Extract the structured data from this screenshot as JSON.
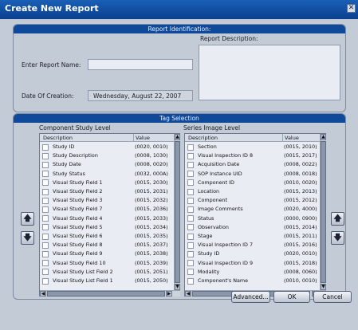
{
  "window": {
    "title": "Create New Report"
  },
  "report_identification": {
    "header": "Report Identification:",
    "name_label": "Enter Report Name:",
    "name_value": "",
    "description_label": "Report Description:",
    "date_label": "Date Of Creation:",
    "date_value": "Wednesday, August 22, 2007"
  },
  "tag_selection": {
    "header": "Tag Selection",
    "component_level": {
      "title": "Component Study Level",
      "columns": [
        "Description",
        "Value"
      ],
      "rows": [
        [
          "Study ID",
          "(0020, 0010)"
        ],
        [
          "Study Description",
          "(0008, 1030)"
        ],
        [
          "Study Date",
          "(0008, 0020)"
        ],
        [
          "Study Status",
          "(0032, 000A)"
        ],
        [
          "Visual Study Field 1",
          "(0015, 2030)"
        ],
        [
          "Visual Study Field 2",
          "(0015, 2031)"
        ],
        [
          "Visual Study Field 3",
          "(0015, 2032)"
        ],
        [
          "Visual Study Field 7",
          "(0015, 2036)"
        ],
        [
          "Visual Study Field 4",
          "(0015, 2033)"
        ],
        [
          "Visual Study Field 5",
          "(0015, 2034)"
        ],
        [
          "Visual Study Field 6",
          "(0015, 2035)"
        ],
        [
          "Visual Study Field 8",
          "(0015, 2037)"
        ],
        [
          "Visual Study Field 9",
          "(0015, 2038)"
        ],
        [
          "Visual Study Field 10",
          "(0015, 2039)"
        ],
        [
          "Visual Study List Field 2",
          "(0015, 2051)"
        ],
        [
          "Visual Study List Field 1",
          "(0015, 2050)"
        ]
      ]
    },
    "series_level": {
      "title": "Series Image Level",
      "columns": [
        "Description",
        "Value"
      ],
      "rows": [
        [
          "Section",
          "(0015, 2010)"
        ],
        [
          "Visual Inspection ID 8",
          "(0015, 2017)"
        ],
        [
          "Acquisition Date",
          "(0008, 0022)"
        ],
        [
          "SOP Instance UID",
          "(0008, 0018)"
        ],
        [
          "Component ID",
          "(0010, 0020)"
        ],
        [
          "Location",
          "(0015, 2013)"
        ],
        [
          "Component",
          "(0015, 2012)"
        ],
        [
          "Image Comments",
          "(0020, 4000)"
        ],
        [
          "Status",
          "(0000, 0900)"
        ],
        [
          "Observation",
          "(0015, 2014)"
        ],
        [
          "Stage",
          "(0015, 2011)"
        ],
        [
          "Visual Inspection ID 7",
          "(0015, 2016)"
        ],
        [
          "Study ID",
          "(0020, 0010)"
        ],
        [
          "Visual Inspection ID 9",
          "(0015, 2018)"
        ],
        [
          "Modality",
          "(0008, 0060)"
        ],
        [
          "Component's Name",
          "(0010, 0010)"
        ]
      ]
    },
    "side_buttons": {
      "up_icon": "up-arrow-icon",
      "down_icon": "down-arrow-icon"
    }
  },
  "footer": {
    "advanced": "Advanced...",
    "ok": "OK",
    "cancel": "Cancel"
  },
  "colors": {
    "accent": "#0f4a9a",
    "background": "#c3cbd7"
  }
}
